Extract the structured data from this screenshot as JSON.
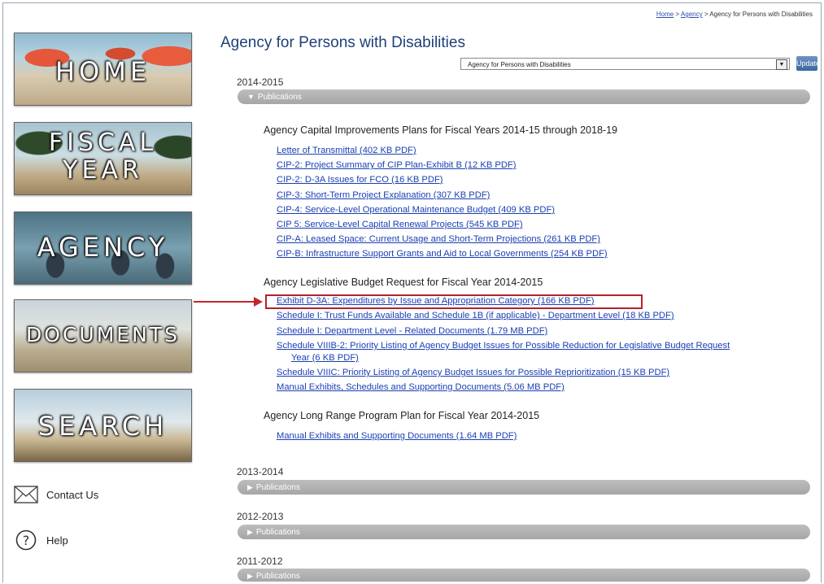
{
  "sidebar": {
    "tiles": [
      {
        "label": "HOME"
      },
      {
        "label": "FISCAL YEAR",
        "line1": "FISCAL",
        "line2": "YEAR"
      },
      {
        "label": "AGENCY"
      },
      {
        "label": "DOCUMENTS"
      },
      {
        "label": "SEARCH"
      }
    ],
    "contact_label": "Contact Us",
    "help_label": "Help",
    "contact_icon": "envelope-icon",
    "help_icon": "question-circle-icon"
  },
  "breadcrumb": {
    "home": "Home",
    "sep1": " > ",
    "agency": "Agency",
    "sep2": " > ",
    "current": "Agency for Persons with Disabilities"
  },
  "main": {
    "title": "Agency for Persons with Disabilities",
    "agency_select_value": "Agency for Persons with Disabilities",
    "update_label": "Update",
    "years": [
      {
        "year": "2014-2015",
        "publications_label": "Publications",
        "expanded": true,
        "sections": [
          {
            "heading": "Agency Capital Improvements Plans for Fiscal Years 2014-15 through 2018-19",
            "links": [
              "Letter of Transmittal (402 KB PDF)",
              "CIP-2: Project Summary of CIP Plan-Exhibit B (12 KB PDF)",
              "CIP-2: D-3A Issues for FCO (16 KB PDF)",
              "CIP-3: Short-Term Project Explanation (307 KB PDF)",
              "CIP-4: Service-Level Operational Maintenance Budget (409 KB PDF)",
              "CIP 5: Service-Level Capital Renewal Projects (545 KB PDF)",
              "CIP-A: Leased Space: Current Usage and Short-Term Projections (261 KB PDF)",
              "CIP-B: Infrastructure Support Grants and Aid to Local Governments (254 KB PDF)"
            ]
          },
          {
            "heading": "Agency Legislative Budget Request for Fiscal Year 2014-2015",
            "links": [
              "Exhibit D-3A: Expenditures by Issue and Appropriation Category (166 KB PDF)",
              "Schedule I: Trust Funds Available and Schedule 1B (if applicable) - Department Level (18 KB PDF)",
              "Schedule I: Department Level - Related Documents (1.79 MB PDF)",
              "Schedule VIIIB-2: Priority Listing of Agency Budget Issues for Possible Reduction for Legislative Budget Request",
              "Year (6 KB PDF)",
              "Schedule VIIIC: Priority Listing of Agency Budget Issues for Possible Reprioritization (15 KB PDF)",
              "Manual Exhibits, Schedules and Supporting Documents (5.06 MB PDF)"
            ]
          },
          {
            "heading": "Agency Long Range Program Plan for Fiscal Year 2014-2015",
            "links": [
              "Manual Exhibits and Supporting Documents (1.64 MB PDF)"
            ]
          }
        ]
      },
      {
        "year": "2013-2014",
        "publications_label": "Publications",
        "expanded": false
      },
      {
        "year": "2012-2013",
        "publications_label": "Publications",
        "expanded": false
      },
      {
        "year": "2011-2012",
        "publications_label": "Publications",
        "expanded": false
      }
    ]
  },
  "annotation": {
    "highlight_color": "#b3222a"
  }
}
